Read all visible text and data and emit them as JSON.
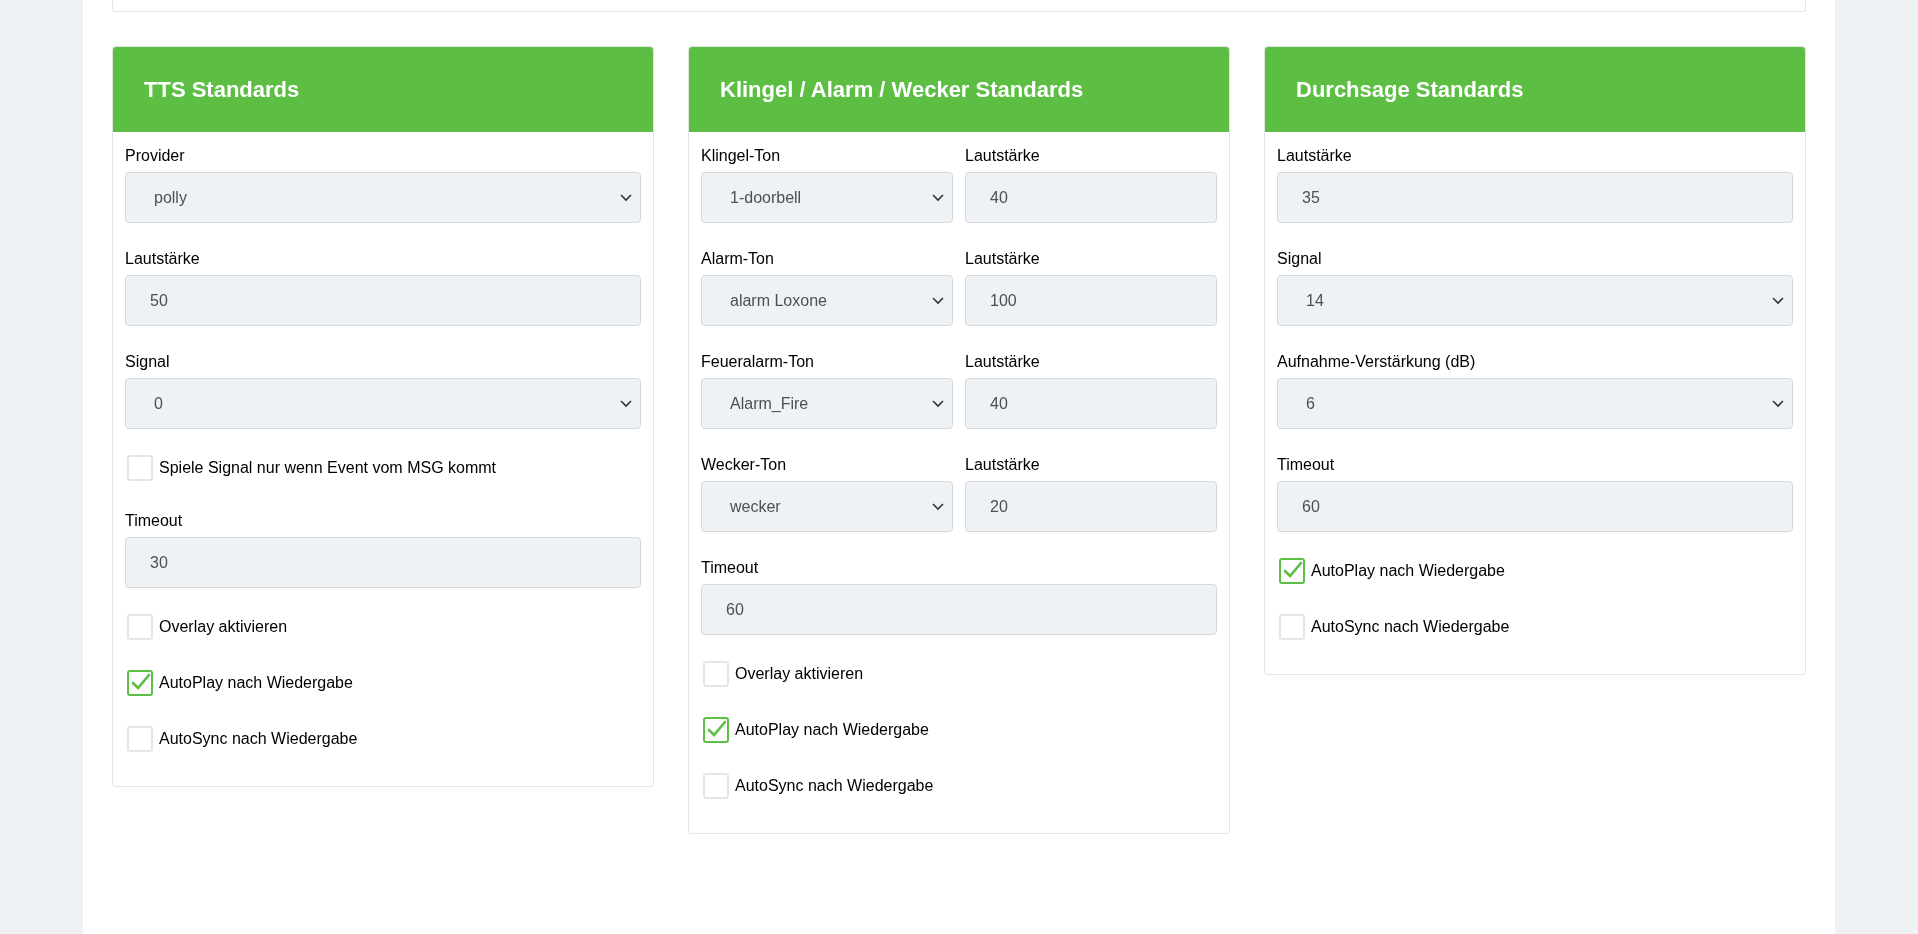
{
  "cards": [
    {
      "title": "TTS Standards",
      "items": [
        {
          "kind": "select",
          "label": "Provider",
          "value": "polly"
        },
        {
          "kind": "input",
          "label": "Lautstärke",
          "value": "50"
        },
        {
          "kind": "select",
          "label": "Signal",
          "value": "0"
        },
        {
          "kind": "checkbox",
          "label": "Spiele Signal nur wenn Event vom MSG kommt",
          "checked": false
        },
        {
          "kind": "input",
          "label": "Timeout",
          "value": "30"
        },
        {
          "kind": "checkbox",
          "label": "Overlay aktivieren",
          "checked": false
        },
        {
          "kind": "checkbox",
          "label": "AutoPlay nach Wiedergabe",
          "checked": true
        },
        {
          "kind": "checkbox",
          "label": "AutoSync nach Wiedergabe",
          "checked": false
        }
      ]
    },
    {
      "title": "Klingel / Alarm / Wecker Standards",
      "items": [
        {
          "kind": "pair",
          "fields": [
            {
              "kind": "select",
              "label": "Klingel-Ton",
              "value": "1-doorbell"
            },
            {
              "kind": "input",
              "label": "Lautstärke",
              "value": "40"
            }
          ]
        },
        {
          "kind": "pair",
          "fields": [
            {
              "kind": "select",
              "label": "Alarm-Ton",
              "value": "alarm Loxone"
            },
            {
              "kind": "input",
              "label": "Lautstärke",
              "value": "100"
            }
          ]
        },
        {
          "kind": "pair",
          "fields": [
            {
              "kind": "select",
              "label": "Feueralarm-Ton",
              "value": "Alarm_Fire"
            },
            {
              "kind": "input",
              "label": "Lautstärke",
              "value": "40"
            }
          ]
        },
        {
          "kind": "pair",
          "fields": [
            {
              "kind": "select",
              "label": "Wecker-Ton",
              "value": "wecker"
            },
            {
              "kind": "input",
              "label": "Lautstärke",
              "value": "20"
            }
          ]
        },
        {
          "kind": "input",
          "label": "Timeout",
          "value": "60"
        },
        {
          "kind": "checkbox",
          "label": "Overlay aktivieren",
          "checked": false
        },
        {
          "kind": "checkbox",
          "label": "AutoPlay nach Wiedergabe",
          "checked": true
        },
        {
          "kind": "checkbox",
          "label": "AutoSync nach Wiedergabe",
          "checked": false
        }
      ]
    },
    {
      "title": "Durchsage Standards",
      "items": [
        {
          "kind": "input",
          "label": "Lautstärke",
          "value": "35"
        },
        {
          "kind": "select",
          "label": "Signal",
          "value": "14"
        },
        {
          "kind": "select",
          "label": "Aufnahme-Verstärkung (dB)",
          "value": "6"
        },
        {
          "kind": "input",
          "label": "Timeout",
          "value": "60"
        },
        {
          "kind": "checkbox",
          "label": "AutoPlay nach Wiedergabe",
          "checked": true
        },
        {
          "kind": "checkbox",
          "label": "AutoSync nach Wiedergabe",
          "checked": false
        }
      ]
    }
  ]
}
